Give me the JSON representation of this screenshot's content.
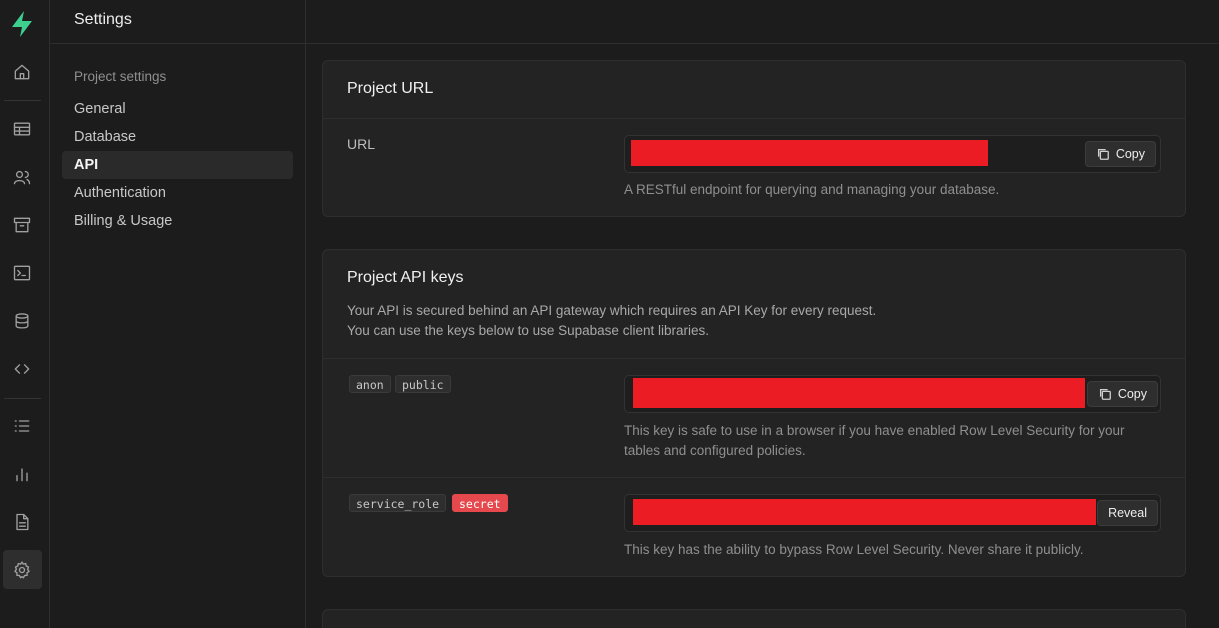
{
  "rail": {
    "icons": [
      "logo-icon",
      "home-icon",
      "table-editor-icon",
      "auth-users-icon",
      "storage-icon",
      "sql-editor-icon",
      "database-icon",
      "api-docs-icon",
      "logs-icon",
      "reports-icon",
      "docs-icon",
      "settings-icon"
    ]
  },
  "nav": {
    "title": "Settings",
    "section": "Project settings",
    "items": [
      {
        "label": "General"
      },
      {
        "label": "Database"
      },
      {
        "label": "API"
      },
      {
        "label": "Authentication"
      },
      {
        "label": "Billing & Usage"
      }
    ],
    "active": "API"
  },
  "project_url": {
    "title": "Project URL",
    "label": "URL",
    "copy": "Copy",
    "help": "A RESTful endpoint for querying and managing your database."
  },
  "api_keys": {
    "title": "Project API keys",
    "desc1": "Your API is secured behind an API gateway which requires an API Key for every request.",
    "desc2": "You can use the keys below to use Supabase client libraries.",
    "anon": {
      "tag1": "anon",
      "tag2": "public",
      "copy": "Copy",
      "help": "This key is safe to use in a browser if you have enabled Row Level Security for your tables and configured policies."
    },
    "service": {
      "tag1": "service_role",
      "tag2": "secret",
      "reveal": "Reveal",
      "help": "This key has the ability to bypass Row Level Security. Never share it publicly."
    }
  },
  "colors": {
    "brand": "#3ecf8e",
    "redaction": "#ec1c24",
    "secret_badge": "#e5484d"
  }
}
